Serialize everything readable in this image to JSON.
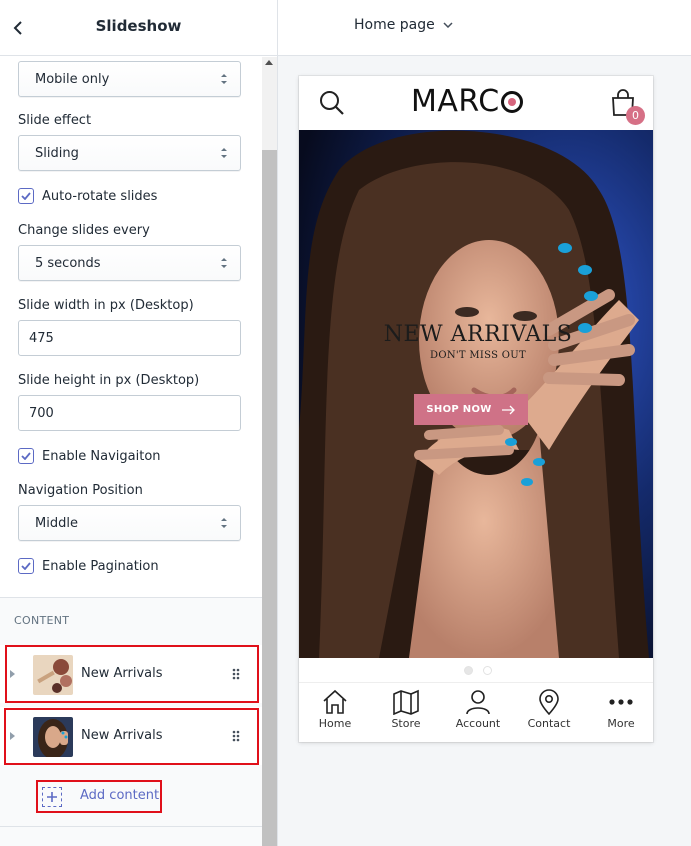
{
  "panel": {
    "title": "Slideshow",
    "show_on_select": "Mobile only",
    "slide_effect": {
      "label": "Slide effect",
      "value": "Sliding"
    },
    "auto_rotate": {
      "label": "Auto-rotate slides",
      "checked": true
    },
    "change_every": {
      "label": "Change slides every",
      "value": "5 seconds"
    },
    "slide_width": {
      "label": "Slide width in px (Desktop)",
      "value": "475"
    },
    "slide_height": {
      "label": "Slide height in px (Desktop)",
      "value": "700"
    },
    "enable_navigation": {
      "label": "Enable Navigaiton",
      "checked": true
    },
    "nav_position": {
      "label": "Navigation Position",
      "value": "Middle"
    },
    "enable_pagination": {
      "label": "Enable Pagination",
      "checked": true
    },
    "content_section": {
      "heading": "CONTENT",
      "items": [
        {
          "label": "New Arrivals"
        },
        {
          "label": "New Arrivals"
        }
      ],
      "add_label": "Add content"
    }
  },
  "preview": {
    "page_select": "Home page",
    "store": {
      "logo": "MARC",
      "cart_count": "0",
      "hero": {
        "title": "NEW ARRIVALS",
        "subtitle": "DON'T MISS OUT",
        "button": "SHOP NOW"
      },
      "bottom_nav": [
        {
          "label": "Home",
          "icon": "home-icon"
        },
        {
          "label": "Store",
          "icon": "map-icon"
        },
        {
          "label": "Account",
          "icon": "user-icon"
        },
        {
          "label": "Contact",
          "icon": "location-pin-icon"
        },
        {
          "label": "More",
          "icon": "more-dots-icon"
        }
      ]
    }
  },
  "colors": {
    "accent": "#5c6ac4",
    "highlight_box": "#e0101a",
    "shop_button": "#cf7287",
    "cart_badge": "#d67086"
  }
}
